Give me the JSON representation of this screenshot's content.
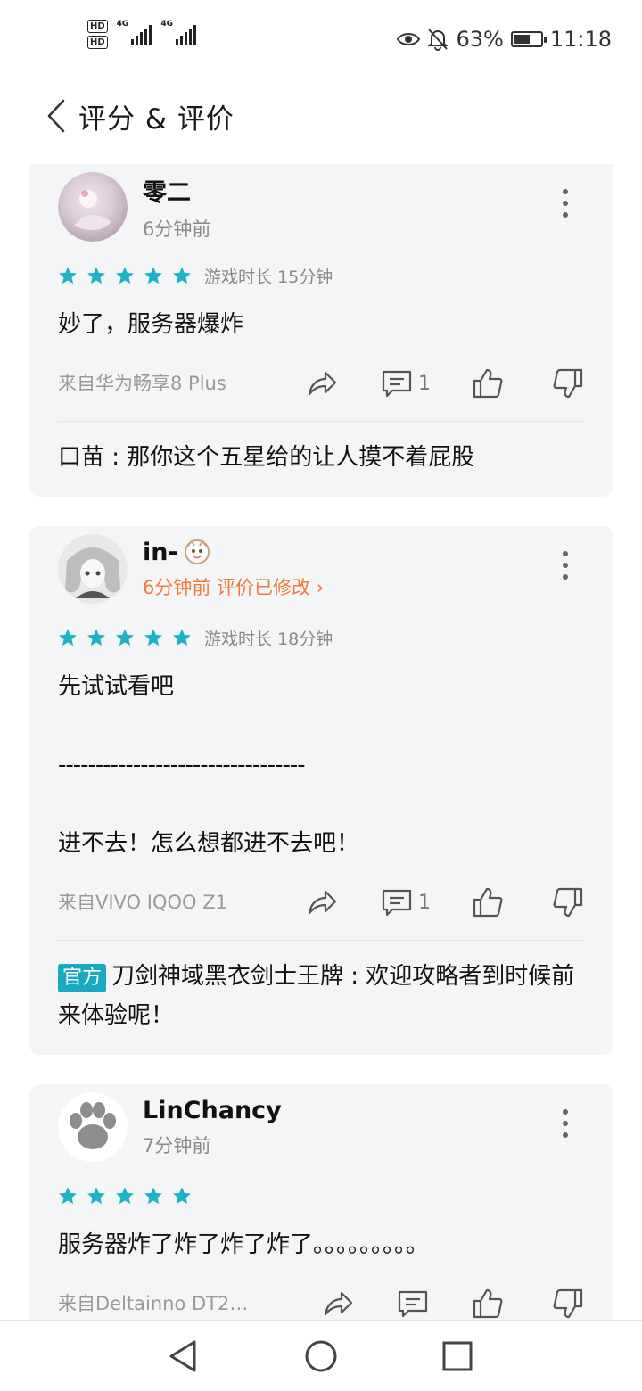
{
  "status_bar": {
    "hd1": "HD",
    "hd2": "HD",
    "network1": "4G",
    "network2": "4G",
    "battery_percent": "63%",
    "time": "11:18",
    "icons": [
      "eye-icon",
      "bell-off-icon",
      "battery-icon"
    ]
  },
  "header": {
    "title": "评分 & 评价",
    "back_icon": "chevron-left-icon"
  },
  "reviews": [
    {
      "username": "零二",
      "time": "6分钟前",
      "stars": 5,
      "playtime": "游戏时长 15分钟",
      "lines": [
        "妙了，服务器爆炸"
      ],
      "device": "来自华为畅享8 Plus",
      "comment_count": "1",
      "reply": "口苗 : 那你这个五星给的让人摸不着屁股"
    },
    {
      "username": "in-",
      "time": "6分钟前",
      "edited": "评价已修改",
      "stars": 5,
      "playtime": "游戏时长 18分钟",
      "lines": [
        "先试试看吧",
        "---------------------------------",
        "进不去！怎么想都进不去吧！"
      ],
      "device": "来自VIVO IQOO Z1",
      "comment_count": "1",
      "reply_badge": "官方",
      "reply": "刀剑神域黑衣剑士王牌 : 欢迎攻略者到时候前来体验呢！"
    },
    {
      "username": "LinChancy",
      "time": "7分钟前",
      "stars": 5,
      "lines": [
        "服务器炸了炸了炸了炸了。。。。。。。。。"
      ],
      "device": "来自Deltainno DT20..."
    }
  ],
  "colors": {
    "accent": "#1aa9c0",
    "star": "#1cb2c7",
    "edited": "#f07a3d",
    "card_bg": "#f3f5f7"
  }
}
